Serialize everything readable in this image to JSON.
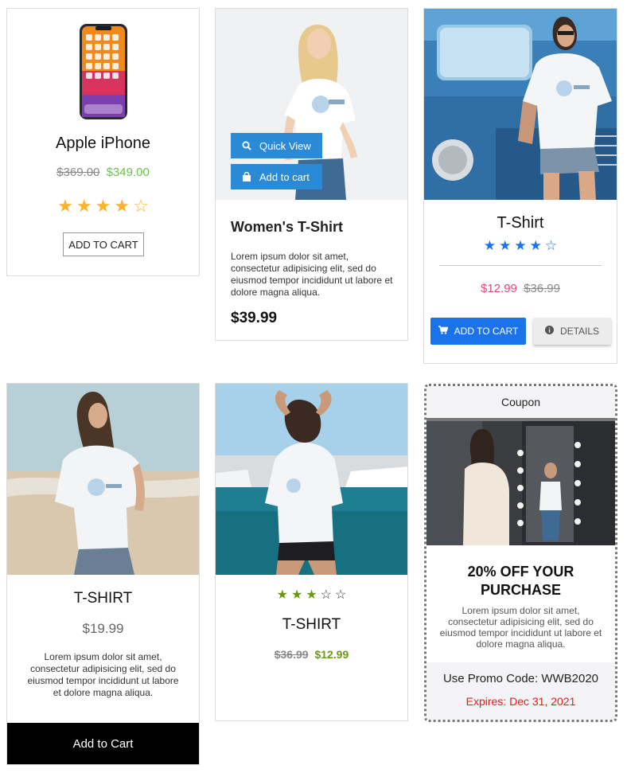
{
  "cards": [
    {
      "title": "Apple iPhone",
      "old_price": "$369.00",
      "new_price": "$349.00",
      "rating": 4,
      "rating_max": 5,
      "button": "ADD TO CART"
    },
    {
      "title": "Women's T-Shirt",
      "quick_view": "Quick View",
      "add_to_cart": "Add to cart",
      "description": "Lorem ipsum dolor sit amet, consectetur adipisicing elit, sed do eiusmod tempor incididunt ut labore et dolore magna aliqua.",
      "price": "$39.99"
    },
    {
      "title": "T-Shirt",
      "rating": 4,
      "rating_max": 5,
      "new_price": "$12.99",
      "old_price": "$36.99",
      "add_button": "ADD TO CART",
      "details_button": "DETAILS"
    },
    {
      "title": "T-SHIRT",
      "price": "$19.99",
      "description": "Lorem ipsum dolor sit amet, consectetur adipisicing elit, sed do eiusmod tempor incididunt ut labore et dolore magna aliqua.",
      "button": "Add to Cart"
    },
    {
      "title": "T-SHIRT",
      "rating": 3,
      "rating_max": 5,
      "old_price": "$36.99",
      "new_price": "$12.99"
    },
    {
      "header": "Coupon",
      "headline": "20% OFF YOUR PURCHASE",
      "description": "Lorem ipsum dolor sit amet, consectetur adipisicing elit, sed do eiusmod tempor incididunt ut labore et dolore magna aliqua.",
      "promo": "Use Promo Code: WWB2020",
      "expires": "Expires: Dec 31, 2021"
    }
  ],
  "colors": {
    "star_gold": "#fbb32b",
    "star_blue": "#1a73e8",
    "star_green": "#6a9a0f",
    "sale_green": "#6abf4b",
    "sale_pink": "#e5457a",
    "quick_view_blue": "#2b8ad6",
    "expiry_red": "#e41b1b"
  },
  "icons": {
    "quick_view": "search-icon",
    "add_to_cart": "shopping-bag-icon",
    "cart": "cart-icon",
    "details": "info-icon"
  }
}
